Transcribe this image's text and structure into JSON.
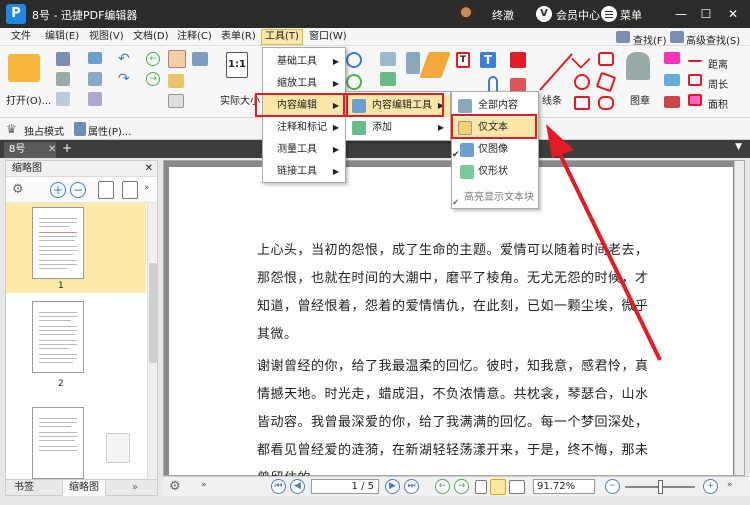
{
  "app": {
    "title": "8号 - 迅捷PDF编辑器",
    "logo_letter": "P",
    "user_name": "终澈",
    "vip_letter": "V",
    "vip_label": "会员中心",
    "menu_label": "菜单",
    "min": "—",
    "max": "☐",
    "close": "✕"
  },
  "menubar": [
    "文件",
    "编辑(E)",
    "视图(V)",
    "文档(D)",
    "注释(C)",
    "表单(R)",
    "工具(T)",
    "窗口(W)"
  ],
  "menubar_active_index": 6,
  "ribbon": {
    "open_label": "打开(O)...",
    "actual_size_label": "实际大小",
    "shapes_label": "线条",
    "stamp_label": "图章",
    "find_label": "查找(F)",
    "adv_find_label": "高级查找(S)",
    "distance_label": "距离",
    "perimeter_label": "周长",
    "area_label": "面积"
  },
  "toolrow2": {
    "exclusive_mode": "独占模式",
    "properties": "属性(P)..."
  },
  "doc_tab": {
    "name": "8号",
    "close": "✕",
    "add": "+"
  },
  "sidebar": {
    "header": "缩略图",
    "close": "✕",
    "thumbs": [
      {
        "num": "1"
      },
      {
        "num": "2"
      }
    ],
    "tabs": [
      "书签",
      "缩略图"
    ],
    "active_tab": 1
  },
  "document": {
    "paragraphs": [
      "上心头，当初的怨恨，成了生命的主题。爱情可以随着时间老去，那怨恨，也就在时间的大潮中，磨平了棱角。无尤无怨的时候，才知道，曾经恨着，怨着的爱情情仇，在此刻，已如一颗尘埃，微乎其微。",
      "谢谢曾经的你，给了我最温柔的回忆。彼时，知我意，感君怜，真情撼天地。时光走，蜡成泪，不负浓情意。共枕衾，琴瑟合，山水皆动容。我曾最深爱的你，给了我满满的回忆。每一个梦回深处，都看见曾经爱的涟漪，在新湖轻轻荡漾开来，于是，终不悔，那未曾留住的"
    ]
  },
  "status": {
    "page_current": "1",
    "page_total": "5",
    "page_display": "1 / 5",
    "zoom": "91.72%"
  },
  "menus": {
    "tools": [
      "基础工具",
      "缩放工具",
      "内容编辑",
      "注释和标记",
      "测量工具",
      "链接工具"
    ],
    "tools_hl_index": 2,
    "content_edit": [
      "内容编辑工具",
      "添加"
    ],
    "content_edit_hl_index": 0,
    "content_tool": [
      "全部内容",
      "仅文本",
      "仅图像",
      "仅形状",
      "高亮显示文本块"
    ],
    "content_tool_hl_index": 1
  },
  "colors": {
    "highlight": "#fbe7a8",
    "red_annotation": "#e21b24",
    "titlebar": "#2b2b2b",
    "accent_blue": "#1e88e5"
  }
}
